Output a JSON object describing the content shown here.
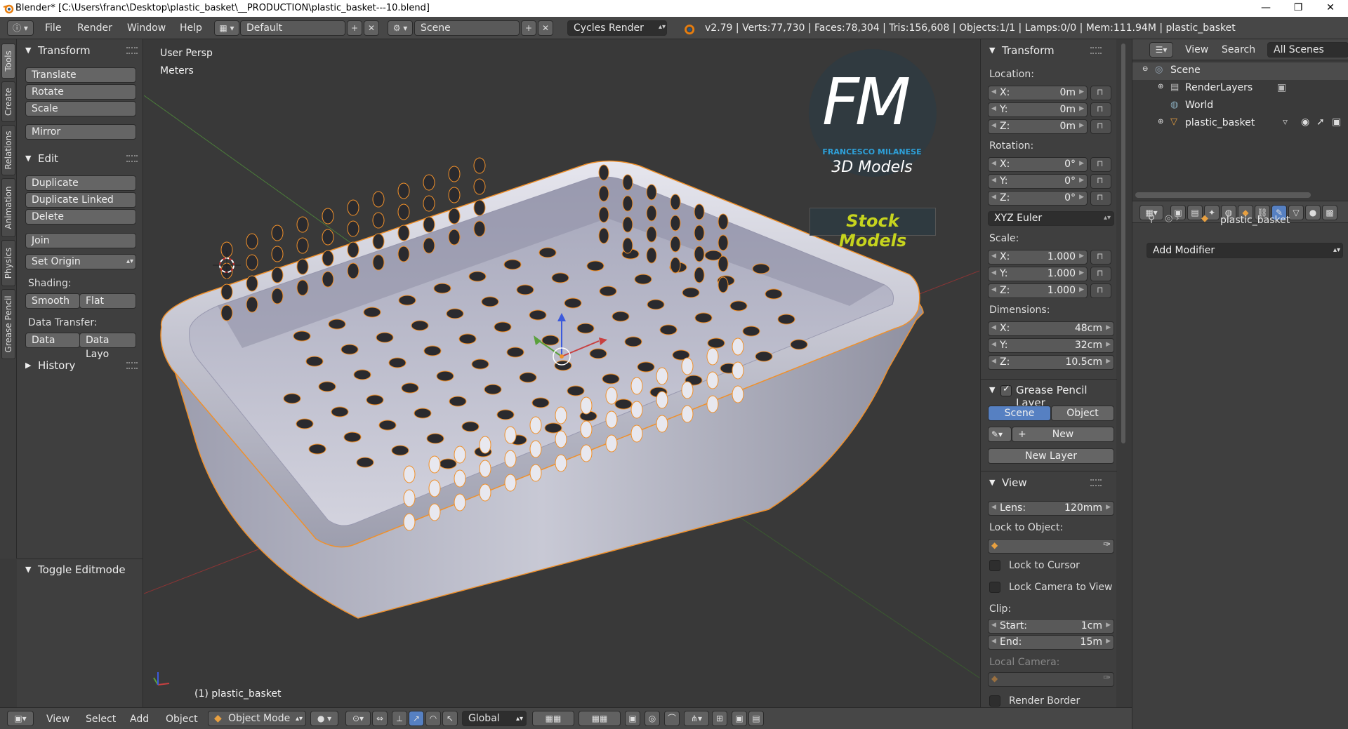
{
  "titlebar": {
    "title": "Blender* [C:\\Users\\franc\\Desktop\\plastic_basket\\__PRODUCTION\\plastic_basket---10.blend]",
    "minimize": "—",
    "maximize": "❐",
    "close": "✕"
  },
  "menu": {
    "items": [
      "File",
      "Render",
      "Window",
      "Help"
    ],
    "layout": "Default",
    "scene": "Scene",
    "engine": "Cycles Render",
    "stats": "v2.79 | Verts:77,730 | Faces:78,304 | Tris:156,608 | Objects:1/1 | Lamps:0/0 | Mem:111.94M | plastic_basket"
  },
  "tooltabs": [
    "Tools",
    "Create",
    "Relations",
    "Animation",
    "Physics",
    "Grease Pencil"
  ],
  "toolshelf": {
    "transform_header": "Transform",
    "translate": "Translate",
    "rotate": "Rotate",
    "scale": "Scale",
    "mirror": "Mirror",
    "edit_header": "Edit",
    "duplicate": "Duplicate",
    "duplicate_linked": "Duplicate Linked",
    "delete": "Delete",
    "join": "Join",
    "set_origin": "Set Origin",
    "shading_label": "Shading:",
    "smooth": "Smooth",
    "flat": "Flat",
    "data_transfer_label": "Data Transfer:",
    "data": "Data",
    "data_layout": "Data Layo",
    "history_header": "History",
    "toggle_editmode": "Toggle Editmode"
  },
  "viewport": {
    "view_name": "User Persp",
    "units": "Meters",
    "object_label": "(1) plastic_basket",
    "watermark": {
      "fm": "FM",
      "author": "FRANCESCO MILANESE",
      "subtitle": "3D Models",
      "banner": "Stock Models"
    }
  },
  "npanel": {
    "transform_header": "Transform",
    "location_label": "Location:",
    "location": [
      {
        "k": "X:",
        "v": "0m"
      },
      {
        "k": "Y:",
        "v": "0m"
      },
      {
        "k": "Z:",
        "v": "0m"
      }
    ],
    "rotation_label": "Rotation:",
    "rotation": [
      {
        "k": "X:",
        "v": "0°"
      },
      {
        "k": "Y:",
        "v": "0°"
      },
      {
        "k": "Z:",
        "v": "0°"
      }
    ],
    "rotation_mode": "XYZ Euler",
    "scale_label": "Scale:",
    "scale": [
      {
        "k": "X:",
        "v": "1.000"
      },
      {
        "k": "Y:",
        "v": "1.000"
      },
      {
        "k": "Z:",
        "v": "1.000"
      }
    ],
    "dimensions_label": "Dimensions:",
    "dimensions": [
      {
        "k": "X:",
        "v": "48cm"
      },
      {
        "k": "Y:",
        "v": "32cm"
      },
      {
        "k": "Z:",
        "v": "10.5cm"
      }
    ],
    "gp_header": "Grease Pencil Layer",
    "gp_scene": "Scene",
    "gp_object": "Object",
    "gp_new": "New",
    "gp_new_layer": "New Layer",
    "view_header": "View",
    "lens_key": "Lens:",
    "lens_value": "120mm",
    "lock_to_object": "Lock to Object:",
    "lock_to_cursor": "Lock to Cursor",
    "lock_camera": "Lock Camera to View",
    "clip_label": "Clip:",
    "clip_start_key": "Start:",
    "clip_start_value": "1cm",
    "clip_end_key": "End:",
    "clip_end_value": "15m",
    "local_camera": "Local Camera:",
    "render_border": "Render Border"
  },
  "outliner": {
    "view": "View",
    "search": "Search",
    "filter": "All Scenes",
    "rows": [
      "Scene",
      "RenderLayers",
      "World",
      "plastic_basket"
    ]
  },
  "properties": {
    "object_name": "plastic_basket",
    "add_modifier": "Add Modifier"
  },
  "bottombar": {
    "view": "View",
    "select": "Select",
    "add": "Add",
    "object": "Object",
    "mode": "Object Mode",
    "orientation": "Global"
  },
  "colors": {
    "accent": "#5680c2",
    "selection_outline": "#f0902a",
    "axis_x": "#c84040",
    "axis_y": "#5aa03c",
    "axis_z": "#3c5adc",
    "banner_text": "#c6d41e",
    "logo_blue": "#2ea0d8"
  }
}
